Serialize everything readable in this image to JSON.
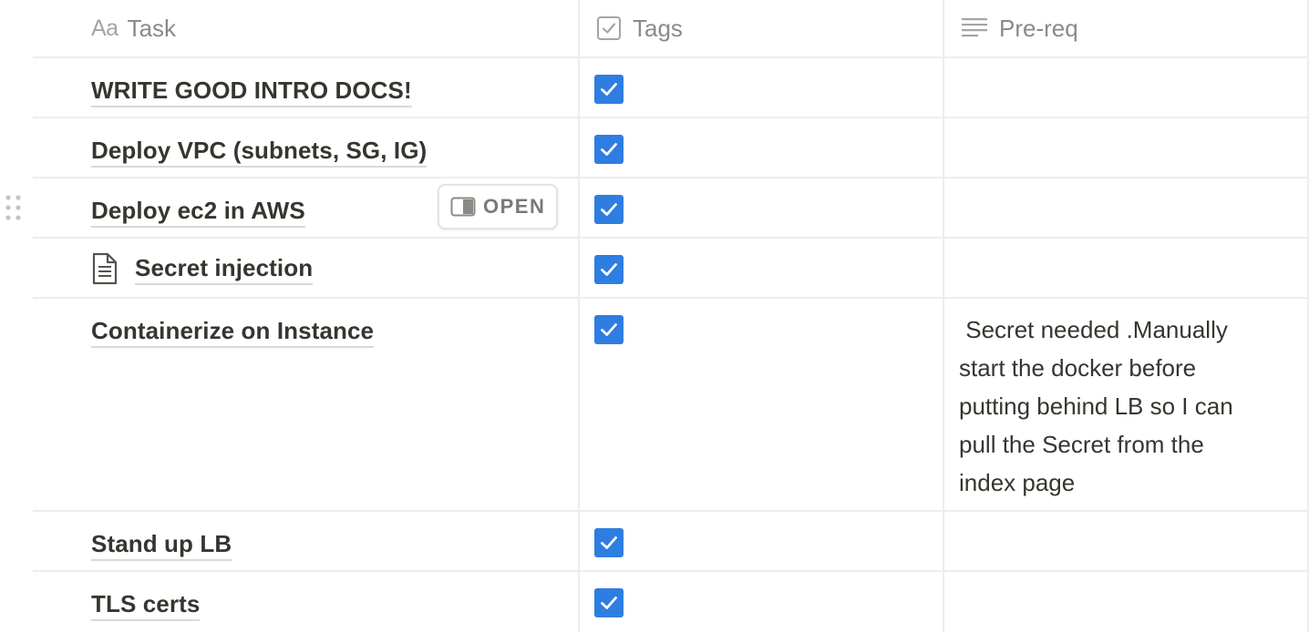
{
  "columns": {
    "task": {
      "icon": "text-aa-icon",
      "icon_text": "Aa",
      "label": "Task"
    },
    "tags": {
      "icon": "checkbox-property-icon",
      "label": "Tags"
    },
    "prereq": {
      "icon": "text-lines-icon",
      "label": "Pre-req"
    }
  },
  "open_button_label": "OPEN",
  "rows": [
    {
      "task": "WRITE GOOD INTRO DOCS!",
      "tags_checked": true,
      "prereq": ""
    },
    {
      "task": "Deploy VPC (subnets, SG, IG)",
      "tags_checked": true,
      "prereq": ""
    },
    {
      "task": "Deploy ec2 in AWS",
      "tags_checked": true,
      "prereq": ""
    },
    {
      "task": "Secret injection",
      "tags_checked": true,
      "prereq": "",
      "has_page_icon": true
    },
    {
      "task": "Containerize on Instance",
      "tags_checked": true,
      "prereq": " Secret needed .Manually\nstart the docker before\nputting behind LB so I can\npull the Secret from the\nindex page"
    },
    {
      "task": "Stand up LB",
      "tags_checked": true,
      "prereq": ""
    },
    {
      "task": "TLS certs",
      "tags_checked": true,
      "prereq": ""
    }
  ],
  "colors": {
    "checkbox_blue": "#2e7de1",
    "border": "#ededeb",
    "text": "#37352f",
    "header_text": "#8a8a87"
  }
}
